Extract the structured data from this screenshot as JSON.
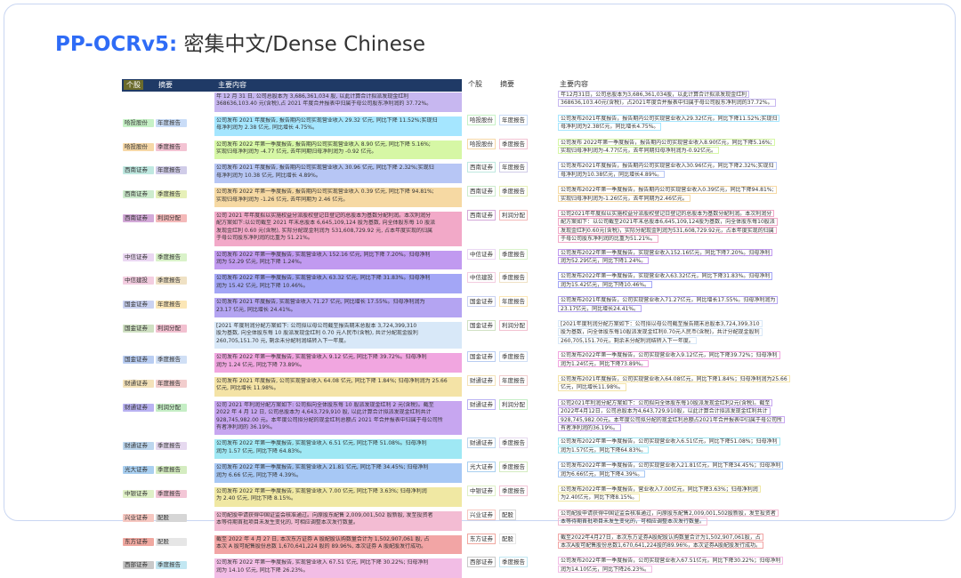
{
  "title": {
    "brand": "PP-OCRv5:",
    "subtitle": " 密集中文/Dense Chinese"
  },
  "image_header": {
    "col1": "个股",
    "col2": "摘要",
    "col3": "主要内容"
  },
  "ocr_header": {
    "col1": "个股",
    "col2": "摘要",
    "col3": "主要内容"
  },
  "rows": [
    {
      "a": "",
      "b": "",
      "lines": [
        "年 12 月 31 日, 公司总股本为 3,686,361,034 股, 以此计算合计拟派发现金红利",
        "368636,103.40 元(含税),占 2021 年度合并报表中归属于母公司股东净利润的 37.72%。"
      ],
      "ocr_a": "",
      "ocr_b": "",
      "ocr_lines": [
        "年12月31日，公司总股本为3,686,361,034股，以此计算合计拟派发现金红利",
        "368636,103.40元(含税)，占2021年度合并报表中归属于母公司股东净利润的37.72%。"
      ],
      "ca": "#f2f0f8",
      "cb": "#f2f0f8",
      "cl": "#c7b7f0"
    },
    {
      "a": "哈投股份",
      "b": "年度报告",
      "lines": [
        "公司发布 2021 年度报告, 报告期内公司实现营业收入 29.32 亿元, 同比下降 11.52%;实现归",
        "母净利润为 2.38 亿元, 同比增长 4.75%。"
      ],
      "ocr_a": "哈投股份",
      "ocr_b": "年度报告",
      "ocr_lines": [
        "公司发布2021年度报告，报告期内公司实现营业收入29.32亿元，同比下降11.52%;实现归",
        "母净利润为2.38亿元，同比增长4.75%。"
      ],
      "ca": "#c6f1c6",
      "cb": "#c9dcf7",
      "cl": "#a5e6ff"
    },
    {
      "a": "哈投股份",
      "b": "季度报告",
      "lines": [
        "公司发布 2022 年第一季度报告, 报告期内公司实现营业收入 8.90 亿元, 同比下降 5.16%;",
        "实现归母净利润为 -4.77 亿元, 去年同期归母净利润为 -0.92 亿元。"
      ],
      "ocr_a": "哈投股份",
      "ocr_b": "季度报告",
      "ocr_lines": [
        "公司发布 2022年第一季度报告，报告期内公司实现营业收入8.90亿元，同比下降5.16%;",
        "实现归母净利润为-4.77亿元，去年同期归母净利润为-0.92亿元。"
      ],
      "ca": "#f6d8a7",
      "cb": "#f3c3d3",
      "cl": "#d6f7a5"
    },
    {
      "a": "西南证券",
      "b": "年度报告",
      "lines": [
        "公司发布 2021 年度报告, 报告期内公司实现营业收入 30.96 亿元, 同比下降 2.32%;实现归",
        "母净利润为 10.38 亿元, 同比增长 4.89%。"
      ],
      "ocr_a": "西南证券",
      "ocr_b": "年度报告",
      "ocr_lines": [
        "公司发布2021年度报告，报告期内公司实现营业收入30.96亿元，同比下降2.32%;实现归",
        "母净利润为10.38亿元，同比增长4.89%。"
      ],
      "ca": "#bfe8e0",
      "cb": "#d0cce8",
      "cl": "#b7c6f5"
    },
    {
      "a": "西南证券",
      "b": "季度报告",
      "lines": [
        "公司发布 2022 年第一季度报告, 报告期内公司实现营业收入 0.39 亿元, 同比下降 94.81%;",
        "实现归母净利润为 -1.26 亿元, 去年同期为 2.46 亿元。"
      ],
      "ocr_a": "西南证券",
      "ocr_b": "季度报告",
      "ocr_lines": [
        "公司发布2022年第一季度报告，报告期内公司实现营业收入0.39亿元，同比下降94.81%;",
        "实现归母净利润为-1.26亿元，去年同期为2.46亿元。"
      ],
      "ca": "#cdeccd",
      "cb": "#e6f0b8",
      "cl": "#f6d9a3"
    },
    {
      "a": "西南证券",
      "b": "利润分配",
      "lines": [
        "公司 2021 年年度拟以实施权益分派股权登记日登记的总股本为基数分配利润。本次利润分",
        "配方案如下:以公司截至 2021 年末总股本 6,645,109,124 股为基数, 向全体股东每 10 股派",
        "发现金红利 0.60 元(含税), 实际分配现金利润为 531,608,729.92 元, 占本年度实现的归属",
        "于母公司股东净利润的比重为 51.21%。"
      ],
      "ocr_a": "西南证券",
      "ocr_b": "利润分配",
      "ocr_lines": [
        "公司2021年年度拟以实施权益分派股权登记日登记的总股本为基数分配利润。本次利润分",
        "配方案如下：以公司截至2021年末总股本6,645,109,124股为基数，向全体股东每10股派",
        "发现金红利0.60元(含税)，实际分配现金利润为531,608,729.92元，占本年度实现的归属",
        "于母公司股东净利润的比重为51.21%。"
      ],
      "ca": "#d3a9d8",
      "cb": "#f4b9b9",
      "cl": "#f2a9c8"
    },
    {
      "a": "中信证券",
      "b": "季度报告",
      "lines": [
        "公司发布 2022 年第一季度报告, 实现营业收入 152.16 亿元, 同比下降 7.20%。归母净利",
        "润为 52.29 亿元, 同比下降 1.24%。"
      ],
      "ocr_a": "中信证券",
      "ocr_b": "季度报告",
      "ocr_lines": [
        "公司发布2022年第一季度报告，实现营业收入152.16亿元，同比下降7.20%。归母净利",
        "润为52.29亿元，同比下降1.24%。"
      ],
      "ca": "#ead7f2",
      "cb": "#d9f2c9",
      "cl": "#c19af0"
    },
    {
      "a": "中信建投",
      "b": "季度报告",
      "lines": [
        "公司发布 2022 年第一季度报告, 实现营业收入 63.32 亿元, 同比下降 31.83%。归母净利",
        "润为 15.42 亿元, 同比下降 10.46%。"
      ],
      "ocr_a": "中信建投",
      "ocr_b": "季度报告",
      "ocr_lines": [
        "公司发布2022年第一季度报告，实现营业收入63.32亿元，同比下降31.83%。归母净利",
        "润为15.42亿元，同比下降10.46%。"
      ],
      "ca": "#f3cde0",
      "cb": "#efe1c4",
      "cl": "#a3a6f6"
    },
    {
      "a": "国金证券",
      "b": "年度报告",
      "lines": [
        "公司发布 2021 年度报告, 实现营业收入 71.27 亿元, 同比增长 17.55%。归母净利润为",
        "23.17 亿元, 同比增长 24.41%。"
      ],
      "ocr_a": "国金证券",
      "ocr_b": "年度报告",
      "ocr_lines": [
        "公司发布2021年度报告，公司实现营业收入71.27亿元，同比增长17.55%。归母净利润为",
        "23.17亿元，同比增长24.41%。"
      ],
      "ca": "#cad2f2",
      "cb": "#fbe6b6",
      "cl": "#b4a4f2"
    },
    {
      "a": "国金证券",
      "b": "利润分配",
      "lines": [
        "[2021 年度利润分配方案如下: 公司拟以母公司截至报告期末总股本 3,724,399,310",
        "股为基数, 向全体股东每 10 股派发现金红利 0.70 元人民币(含税), 共计分配现金股利",
        "260,705,151.70 元, 剩余未分配利润结转入下一年度。"
      ],
      "ocr_a": "国金证券",
      "ocr_b": "利润分配",
      "ocr_lines": [
        "[2021年度利润分配方案如下：公司拟以母公司截至报告期末总股本3,724,399,310",
        "股为基数，向全体股东每10股派发现金红利0.70元人民币(含税)，共计分配现金股利",
        "260,705,151.70元，剩余未分配利润结转入下一年度。"
      ],
      "ca": "#cfe0c2",
      "cb": "#f2c0d0",
      "cl": "#d8e8f8"
    },
    {
      "a": "国金证券",
      "b": "季度报告",
      "lines": [
        "公司发布 2022 年第一季度报告, 实现营业收入 9.12 亿元, 同比下降 39.72%。归母净利",
        "润为 1.24 亿元, 同比下降 73.89%。"
      ],
      "ocr_a": "国金证券",
      "ocr_b": "季度报告",
      "ocr_lines": [
        "公司发布2022年第一季度报告，公司实现营业收入9.12亿元，同比下降39.72%；归母净利",
        "润为1.24亿元，同比下降73.89%。"
      ],
      "ca": "#b9cdf2",
      "cb": "#d0dff5",
      "cl": "#f1a6e0"
    },
    {
      "a": "财通证券",
      "b": "年度报告",
      "lines": [
        "公司发布 2021 年度报告, 公司实现营业收入 64.08 亿元, 同比下降 1.84%; 归母净利润为 25.66",
        "亿元, 同比增长 11.98%。"
      ],
      "ocr_a": "财通证券",
      "ocr_b": "年度报告",
      "ocr_lines": [
        "公司发布2021年度报告，公司实现营业收入64.08亿元，同比下降1.84%；归母净利润为25.66",
        "亿元，同比增长11.98%。"
      ],
      "ca": "#f4e2b9",
      "cb": "#f2cdcd",
      "cl": "#f4e3a6"
    },
    {
      "a": "财通证券",
      "b": "利润分配",
      "lines": [
        "公司 2021 年利润分配方案如下: 公司拟向全体股东每 10 股派发现金红利 2 元(含税)。截至",
        "2022 年 4 月 12 日, 公司总股本为 4,643,729,910 股, 以此计算合计拟派发现金红利共计",
        "928,745,982.00 元。本年度公司拟分配的现金红利总额占 2021 年合并报表中归属于母公司所",
        "有者净利润的 36.19%。"
      ],
      "ocr_a": "财通证券",
      "ocr_b": "利润分配",
      "ocr_lines": [
        "公司2021年利润分配方案如下：公司拟向全体股东每10股派发现金红利2元(含税)。截至",
        "2022年4月12日，公司总股本为4,643,729,910股，以此计算合计拟派发现金红利共计",
        "928,745,982.00元。本年度公司拟分配的现金红利总额占2021年合并报表中归属于母公司所",
        "有者净利润的36.19%。"
      ],
      "ca": "#b9b2f2",
      "cb": "#c5eec5",
      "cl": "#c7a6f0"
    },
    {
      "a": "财通证券",
      "b": "季度报告",
      "lines": [
        "公司发布 2022 年第一季度报告, 实现营业收入 6.51 亿元, 同比下降 51.08%。归母净利",
        "润为 1.57 亿元, 同比下降 64.83%。"
      ],
      "ocr_a": "财通证券",
      "ocr_b": "季度报告",
      "ocr_lines": [
        "公司发布2022年第一季度报告，公司实现营业收入6.51亿元，同比下降51.08%；归母净利",
        "润为1.57亿元，同比下降64.83%。"
      ],
      "ca": "#bcd6ee",
      "cb": "#e6d9ef",
      "cl": "#9fe8f4"
    },
    {
      "a": "光大证券",
      "b": "季度报告",
      "lines": [
        "公司发布 2022 年第一季度报告, 实现营业收入 21.81 亿元, 同比下降 34.45%; 归母净利",
        "润为 6.66 亿元, 同比下降 4.39%。"
      ],
      "ocr_a": "光大证券",
      "ocr_b": "季度报告",
      "ocr_lines": [
        "公司发布2022年第一季度报告，公司实现营业收入21.81亿元，同比下降34.45%；归母净利",
        "润为6.66亿元，同比下降4.39%。"
      ],
      "ca": "#a9cff0",
      "cb": "#d4ecc0",
      "cl": "#a7c8f5"
    },
    {
      "a": "中银证券",
      "b": "季度报告",
      "lines": [
        "公司发布 2022 年第一季度报告, 实现营业收入 7.00 亿元, 同比下降 3.63%; 归母净利润",
        "为 2.40 亿元, 同比下降 8.15%。"
      ],
      "ocr_a": "中银证券",
      "ocr_b": "季度报告",
      "ocr_lines": [
        "公司发布2022年第一季度报告，营业收入7.00亿元，同比下降3.63%；归母净利润",
        "为2.40亿元，同比下降8.15%。"
      ],
      "ca": "#dff0c7",
      "cb": "#f3c6d6",
      "cl": "#f0e8a3"
    },
    {
      "a": "兴业证券",
      "b": "配股",
      "lines": [
        "公司配股申请获得中国证监会核准通过。向原股东配售 2,009,001,502 股新股, 发至投资者",
        "本等待期首批项目未发生变化的, 可相应调整本次发行数量。"
      ],
      "ocr_a": "兴业证券",
      "ocr_b": "配股",
      "ocr_lines": [
        "公司配股申请获得中国证监会核准通过，向原股东配售2,009,001,502股新股，发至投资者",
        "本等待期首批项目未发生变化的，可相应调整本次发行数量。"
      ],
      "ca": "#f6c7c0",
      "cb": "#d6d6d6",
      "cl": "#f3bcd3"
    },
    {
      "a": "东方证券",
      "b": "配股",
      "lines": [
        "截至 2022 年 4 月 27 日, 本次东方证券 A 股配股认购数量合计为 1,502,907,061 股, 占",
        "本次 A 股可配售股份总数 1,670,641,224 股的 89.96%, 本次证券 A 股配股发行成功。"
      ],
      "ocr_a": "东方证券",
      "ocr_b": "配股",
      "ocr_lines": [
        "截至2022年4月27日，本次东方证券A股配股认购数量合计为1,502,907,061股，占",
        "本次A股可配售股份总数1,670,641,224股的89.96%，本次证券A股配股发行成功。"
      ],
      "ca": "#f0a8a0",
      "cb": "#e6e6e6",
      "cl": "#f2a5a5"
    },
    {
      "a": "西部证券",
      "b": "季度报告",
      "lines": [
        "公司发布 2022 年第一季度报告, 实现营业收入 67.51 亿元, 同比下降 30.22%; 归母净利",
        "润为 14.10 亿元, 同比下降 26.23%。"
      ],
      "ocr_a": "西部证券",
      "ocr_b": "季度报告",
      "ocr_lines": [
        "公司发布2022年第一季度报告，公司实现营业收入67.51亿元，同比下降30.22%；归母净利",
        "润为14.10亿元，同比下降26.23%。"
      ],
      "ca": "#c9c9c9",
      "cb": "#c2e7f2",
      "cl": "#f2bde5"
    }
  ]
}
